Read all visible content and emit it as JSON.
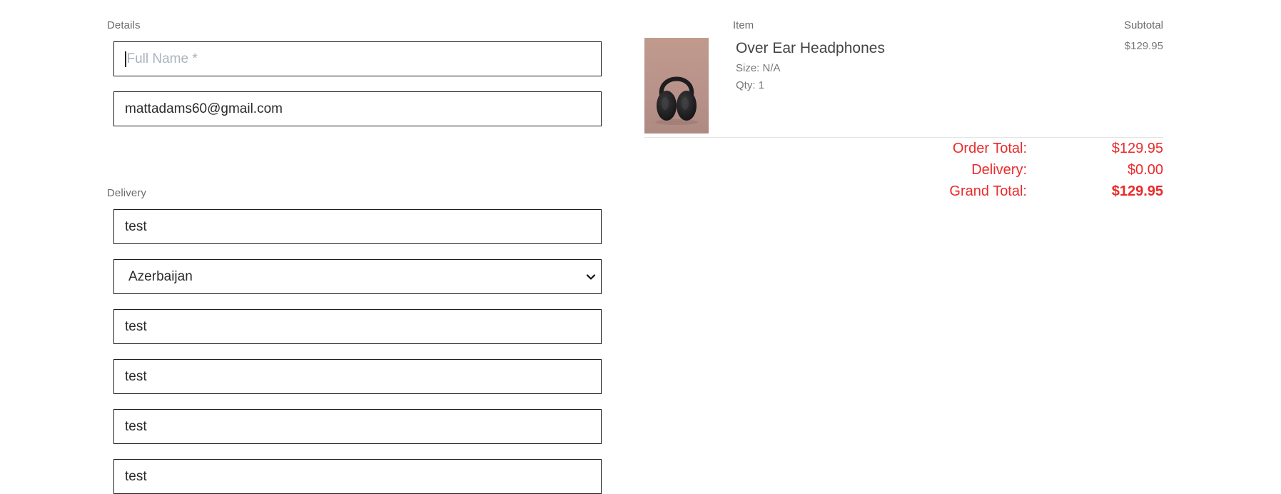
{
  "details": {
    "label": "Details",
    "full_name_placeholder": "Full Name *",
    "email_value": "mattadams60@gmail.com"
  },
  "delivery": {
    "label": "Delivery",
    "fields": [
      "test",
      "test",
      "test",
      "test",
      "test"
    ],
    "country_value": "Azerbaijan"
  },
  "summary": {
    "item_header": "Item",
    "subtotal_header": "Subtotal",
    "item": {
      "name": "Over Ear Headphones",
      "size": "Size: N/A",
      "qty": "Qty: 1",
      "subtotal": "$129.95",
      "thumbnail_icon": "headphones-icon"
    },
    "totals": {
      "order_total_label": "Order Total:",
      "order_total_value": "$129.95",
      "delivery_label": "Delivery:",
      "delivery_value": "$0.00",
      "grand_total_label": "Grand Total:",
      "grand_total_value": "$129.95"
    }
  },
  "colors": {
    "accent": "#ea2a2a",
    "input_border": "#1c1c1c",
    "muted_text": "#6b6b6b"
  }
}
